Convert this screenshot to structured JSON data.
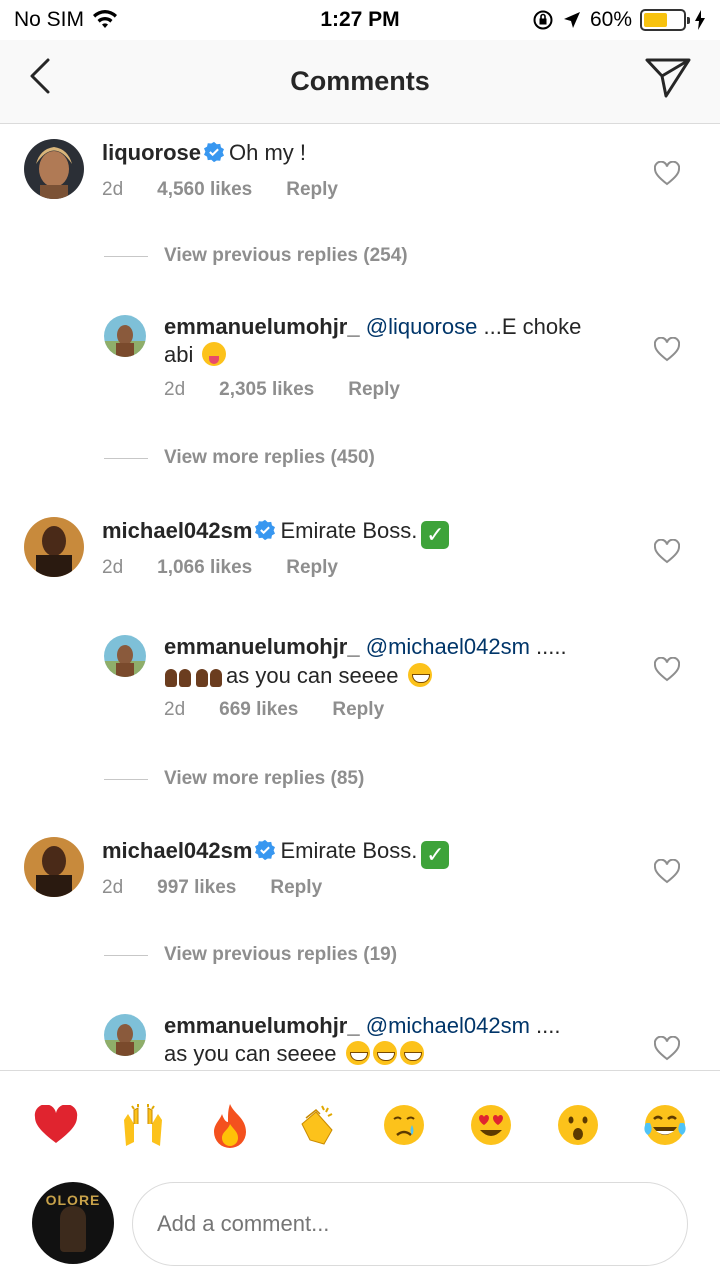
{
  "status_bar": {
    "carrier": "No SIM",
    "time": "1:27 PM",
    "battery_percent": "60%",
    "battery_level": 0.6
  },
  "nav": {
    "title": "Comments"
  },
  "comments": [
    {
      "user": "liquorose",
      "text": "Oh my !",
      "time": "2d",
      "likes": "4,560 likes",
      "reply": "Reply"
    },
    {
      "view_more": "View previous replies (254)"
    },
    {
      "user": "emmanuelumohjr_",
      "mention": "@liquorose",
      "text": "...E choke",
      "text2": "abi",
      "time": "2d",
      "likes": "2,305 likes",
      "reply": "Reply"
    },
    {
      "view_more": "View more replies (450)"
    },
    {
      "user": "michael042sm",
      "text": "Emirate Boss.",
      "time": "2d",
      "likes": "1,066 likes",
      "reply": "Reply"
    },
    {
      "user": "emmanuelumohjr_",
      "mention": "@michael042sm",
      "text": ".....",
      "text2": "as you can seeee",
      "time": "2d",
      "likes": "669 likes",
      "reply": "Reply"
    },
    {
      "view_more": "View more replies (85)"
    },
    {
      "user": "michael042sm",
      "text": "Emirate Boss.",
      "time": "2d",
      "likes": "997 likes",
      "reply": "Reply"
    },
    {
      "view_more": "View previous replies (19)"
    },
    {
      "user": "emmanuelumohjr_",
      "mention": "@michael042sm",
      "text": "....",
      "text2": "as you can seeee"
    }
  ],
  "quick_reactions": [
    "❤️",
    "🙌",
    "🔥",
    "👏",
    "😢",
    "😍",
    "😮",
    "😂"
  ],
  "composer": {
    "avatar_text": "OLORE",
    "placeholder": "Add a comment..."
  },
  "colors": {
    "mention": "#003569",
    "verified": "#3897f0",
    "muted": "#8e8e8e",
    "battery": "#f7c20f"
  }
}
